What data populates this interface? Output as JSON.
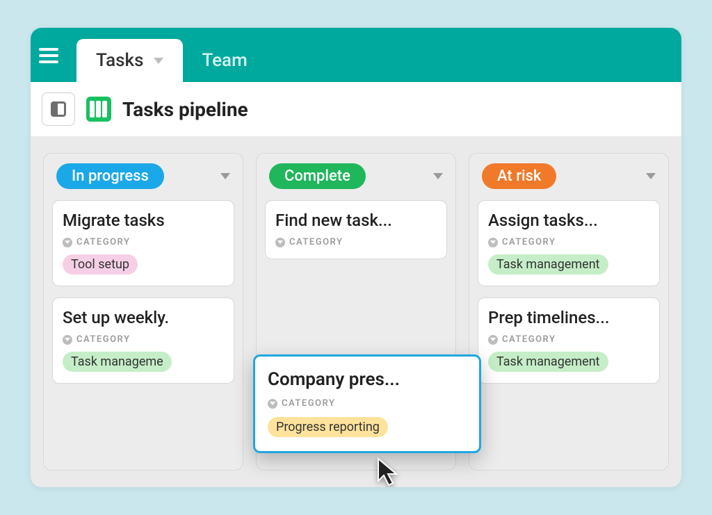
{
  "tabs": {
    "active": "Tasks",
    "secondary": "Team"
  },
  "board": {
    "title": "Tasks pipeline"
  },
  "category_label": "CATEGORY",
  "columns": [
    {
      "name": "In progress",
      "pill_class": "pill-blue",
      "cards": [
        {
          "title": "Migrate tasks",
          "tag": "Tool setup",
          "tag_class": "tag-pink"
        },
        {
          "title": "Set up weekly.",
          "tag": "Task manageme",
          "tag_class": "tag-green"
        }
      ]
    },
    {
      "name": "Complete",
      "pill_class": "pill-green",
      "cards": [
        {
          "title": "Find new task...",
          "tag": "",
          "tag_class": ""
        }
      ]
    },
    {
      "name": "At risk",
      "pill_class": "pill-orange",
      "cards": [
        {
          "title": "Assign tasks...",
          "tag": "Task management",
          "tag_class": "tag-green"
        },
        {
          "title": "Prep timelines...",
          "tag": "Task management",
          "tag_class": "tag-green"
        }
      ]
    }
  ],
  "dragging_card": {
    "title": "Company pres...",
    "tag": "Progress reporting",
    "tag_class": "tag-yellow"
  }
}
